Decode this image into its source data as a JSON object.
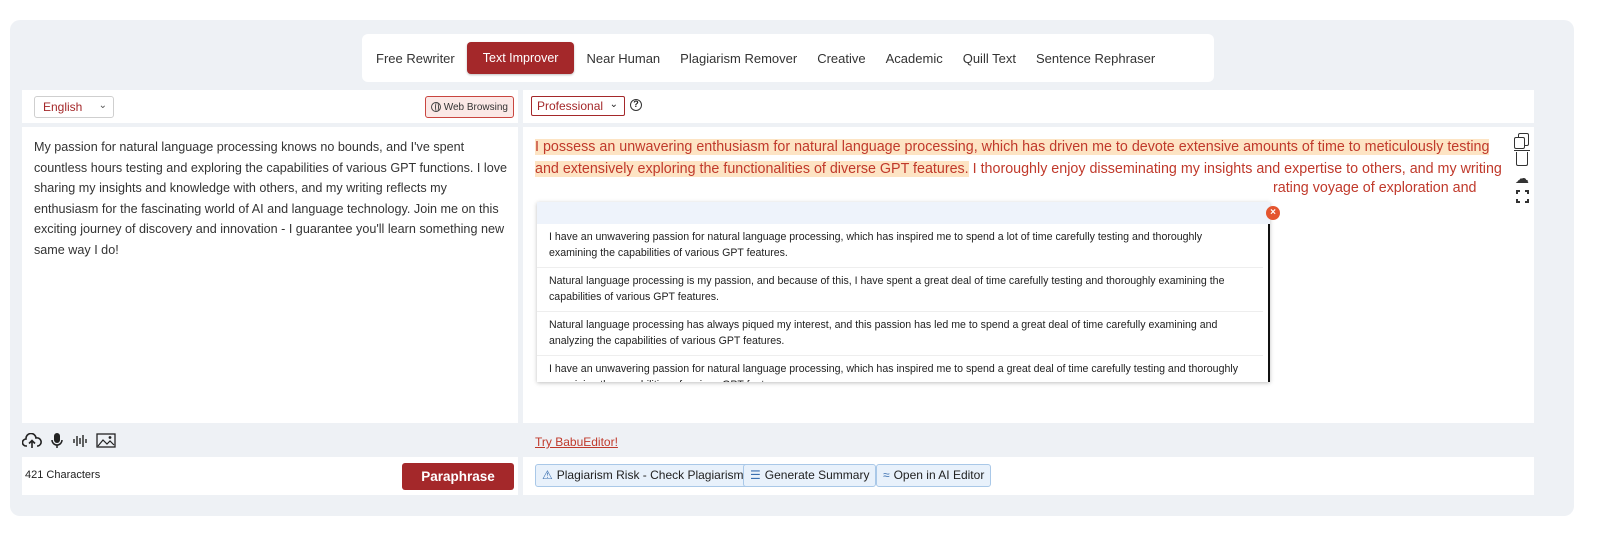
{
  "modes": [
    "Free Rewriter",
    "Text Improver",
    "Near Human",
    "Plagiarism Remover",
    "Creative",
    "Academic",
    "Quill Text",
    "Sentence Rephraser"
  ],
  "active_mode": "Text Improver",
  "left": {
    "language": "English",
    "web_browsing": "Web Browsing",
    "input_text": "My passion for natural language processing knows no bounds, and I've spent countless hours testing and exploring the capabilities of various GPT functions. I love sharing my insights and knowledge with others, and my writing reflects my enthusiasm for the fascinating world of AI and language technology. Join me on this exciting journey of discovery and innovation - I guarantee you'll learn something new same way I do!",
    "char_count": "421 Characters",
    "paraphrase": "Paraphrase"
  },
  "right": {
    "tone": "Professional",
    "output_highlight": "I possess an unwavering enthusiasm for natural language processing, which has driven me to devote extensive amounts of time to meticulously testing and extensively exploring the functionalities of diverse GPT features.",
    "output_rest": " I thoroughly enjoy disseminating my insights and expertise to others, and my writing",
    "output_tail": "rating voyage of exploration and",
    "alternatives": [
      "I have an unwavering passion for natural language processing, which has inspired me to spend a lot of time carefully testing and thoroughly examining the capabilities of various GPT features.",
      "Natural language processing is my passion, and because of this, I have spent a great deal of time carefully testing and thoroughly examining the capabilities of various GPT features.",
      "Natural language processing has always piqued my interest, and this passion has led me to spend a great deal of time carefully examining and analyzing the capabilities of various GPT features.",
      "I have an unwavering passion for natural language processing, which has inspired me to spend a great deal of time carefully testing and thoroughly examining the capabilities of various GPT features."
    ],
    "try_link": "Try BabuEditor!",
    "footer_buttons": [
      "Plagiarism Risk - Check Plagiarism",
      "Generate Summary",
      "Open in AI Editor"
    ]
  },
  "colors": {
    "brand": "#a4282a",
    "output_text": "#c0392b",
    "highlight": "#fde4c4",
    "footer_btn_bg": "#e8f1fb"
  },
  "icons": [
    "upload-cloud-icon",
    "microphone-icon",
    "waveform-icon",
    "image-icon",
    "copy-icon",
    "trash-icon",
    "download-cloud-icon",
    "fullscreen-icon",
    "help-icon",
    "globe-icon",
    "close-icon"
  ]
}
